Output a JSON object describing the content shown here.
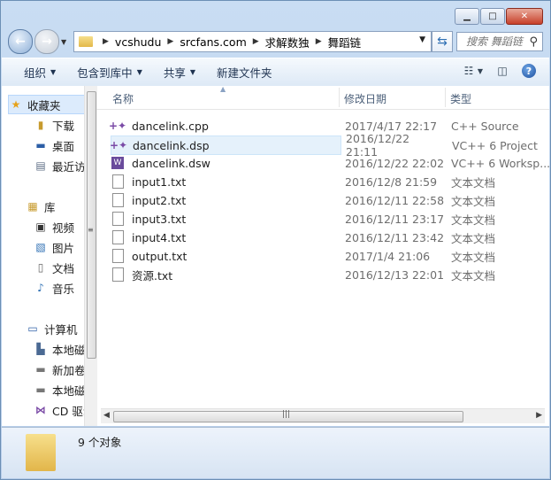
{
  "window": {
    "minimize_glyph": "▁",
    "maximize_glyph": "□",
    "close_glyph": "✕"
  },
  "address": {
    "crumbs": [
      "vcshudu",
      "srcfans.com",
      "求解数独",
      "舞蹈链"
    ],
    "search_placeholder": "搜索 舞蹈链"
  },
  "toolbar": {
    "items": [
      "组织",
      "包含到库中",
      "共享",
      "新建文件夹"
    ]
  },
  "nav": {
    "favorites_label": "收藏夹",
    "favorites": [
      "下载",
      "桌面",
      "最近访问的位置"
    ],
    "libraries_label": "库",
    "libraries": [
      "视频",
      "图片",
      "文档",
      "音乐"
    ],
    "computer_label": "计算机",
    "drives": [
      "本地磁盘 (C:)",
      "新加卷 (D:)",
      "本地磁盘 (E:)",
      "CD 驱动器 (F:)"
    ]
  },
  "columns": {
    "name": "名称",
    "date": "修改日期",
    "type": "类型"
  },
  "files": [
    {
      "name": "dancelink.cpp",
      "date": "2017/4/17 22:17",
      "type": "C++ Source",
      "icon": "cpp-icon"
    },
    {
      "name": "dancelink.dsp",
      "date": "2016/12/22 21:11",
      "type": "VC++ 6 Project",
      "icon": "dsp-icon"
    },
    {
      "name": "dancelink.dsw",
      "date": "2016/12/22 22:02",
      "type": "VC++ 6 Worksp...",
      "icon": "dsw-icon"
    },
    {
      "name": "input1.txt",
      "date": "2016/12/8 21:59",
      "type": "文本文档",
      "icon": "txt-icon"
    },
    {
      "name": "input2.txt",
      "date": "2016/12/11 22:58",
      "type": "文本文档",
      "icon": "txt-icon"
    },
    {
      "name": "input3.txt",
      "date": "2016/12/11 23:17",
      "type": "文本文档",
      "icon": "txt-icon"
    },
    {
      "name": "input4.txt",
      "date": "2016/12/11 23:42",
      "type": "文本文档",
      "icon": "txt-icon"
    },
    {
      "name": "output.txt",
      "date": "2017/1/4 21:06",
      "type": "文本文档",
      "icon": "txt-icon"
    },
    {
      "name": "资源.txt",
      "date": "2016/12/13 22:01",
      "type": "文本文档",
      "icon": "txt-icon"
    }
  ],
  "status": {
    "count_text": "9 个对象"
  }
}
